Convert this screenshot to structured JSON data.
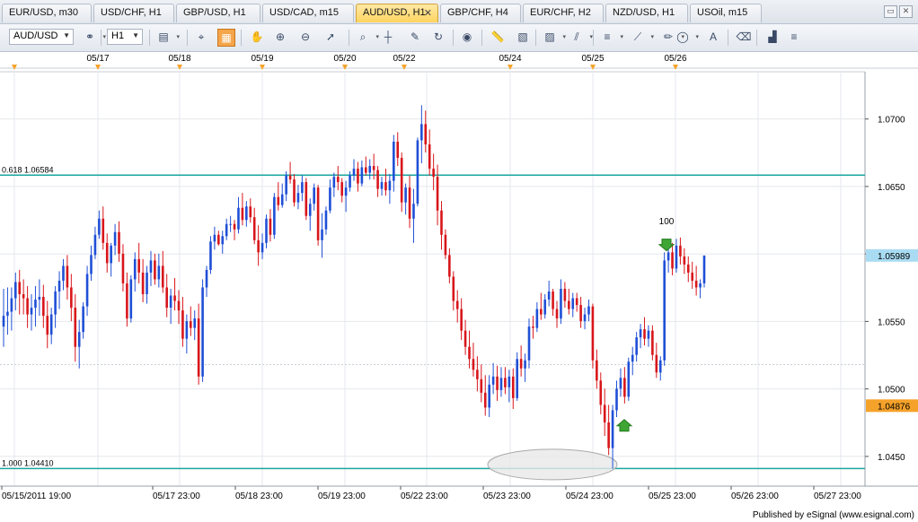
{
  "tabs": [
    {
      "label": "EUR/USD, m30",
      "active": false
    },
    {
      "label": "USD/CHF, H1",
      "active": false
    },
    {
      "label": "GBP/USD, H1",
      "active": false
    },
    {
      "label": "USD/CAD, m15",
      "active": false
    },
    {
      "label": "AUD/USD, H1",
      "active": true,
      "close": "✕"
    },
    {
      "label": "GBP/CHF, H4",
      "active": false
    },
    {
      "label": "EUR/CHF, H2",
      "active": false
    },
    {
      "label": "NZD/USD, H1",
      "active": false
    },
    {
      "label": "USOil, m15",
      "active": false
    }
  ],
  "toolbar": {
    "symbol": "AUD/USD",
    "interval": "H1",
    "icons": [
      "link-icon",
      "bar-chart-icon",
      "cursor-icon",
      "data-window-icon",
      "hand-icon",
      "zoom-in-icon",
      "zoom-out-icon",
      "pointer-icon",
      "zoom-box-icon",
      "crosshair-icon",
      "notes-icon",
      "rotate-icon",
      "globe-icon",
      "ruler-icon",
      "image-icon",
      "template-icon",
      "lines-icon",
      "fib-icon",
      "trend-icon",
      "pencil-icon",
      "ellipse-icon",
      "text-icon",
      "eraser-icon",
      "indicators-icon",
      "more-icon"
    ]
  },
  "chart_data": {
    "type": "candlestick",
    "symbol": "AUD/USD",
    "interval": "H1",
    "top_date_labels": [
      "05/17",
      "05/18",
      "05/19",
      "05/20",
      "05/22",
      "05/24",
      "05/25",
      "05/26"
    ],
    "x_labels": [
      "05/15/2011 19:00",
      "05/17 23:00",
      "05/18 23:00",
      "05/19 23:00",
      "05/22 23:00",
      "05/23 23:00",
      "05/24 23:00",
      "05/25 23:00",
      "05/26 23:00",
      "05/27 23:00"
    ],
    "y_ticks": [
      "1.0700",
      "1.0650",
      "1.0600",
      "1.0550",
      "1.0500",
      "1.0450"
    ],
    "ylim": [
      1.0428,
      1.0735
    ],
    "current_price": "1.05989",
    "marker_price": "1.04876",
    "levels": [
      {
        "label": "0.618 1.06584",
        "value": 1.06584
      },
      {
        "label": "1.000 1.04410",
        "value": 1.0441
      }
    ],
    "annotation_text": "100",
    "colors": {
      "up": "#1f4fd6",
      "down": "#d8161b",
      "level": "#1aa6a0",
      "current_bg": "#a9dcf3",
      "marker_bg": "#f5a22a",
      "grid": "#e4e7ec"
    },
    "ohlc": [
      [
        1.05462,
        1.05742,
        1.05312,
        1.05542
      ],
      [
        1.05542,
        1.05752,
        1.05402,
        1.05572
      ],
      [
        1.05572,
        1.05752,
        1.05432,
        1.05672
      ],
      [
        1.05672,
        1.05862,
        1.05582,
        1.05792
      ],
      [
        1.05792,
        1.05882,
        1.05552,
        1.05702
      ],
      [
        1.05702,
        1.05812,
        1.05552,
        1.05672
      ],
      [
        1.05672,
        1.05762,
        1.05452,
        1.05552
      ],
      [
        1.05552,
        1.05702,
        1.05432,
        1.05602
      ],
      [
        1.05602,
        1.05762,
        1.05462,
        1.05662
      ],
      [
        1.05662,
        1.05812,
        1.05542,
        1.05682
      ],
      [
        1.05682,
        1.05772,
        1.05452,
        1.05542
      ],
      [
        1.05542,
        1.05652,
        1.05302,
        1.05402
      ],
      [
        1.05402,
        1.05602,
        1.05332,
        1.05552
      ],
      [
        1.05552,
        1.05762,
        1.05452,
        1.05722
      ],
      [
        1.05722,
        1.05872,
        1.05592,
        1.05802
      ],
      [
        1.05802,
        1.05962,
        1.05732,
        1.05912
      ],
      [
        1.05912,
        1.05992,
        1.05662,
        1.05752
      ],
      [
        1.05752,
        1.05852,
        1.05502,
        1.05602
      ],
      [
        1.05602,
        1.05702,
        1.05202,
        1.05312
      ],
      [
        1.05312,
        1.05512,
        1.05152,
        1.05422
      ],
      [
        1.05422,
        1.05642,
        1.05372,
        1.05612
      ],
      [
        1.05612,
        1.05912,
        1.05542,
        1.05852
      ],
      [
        1.05852,
        1.06062,
        1.05802,
        1.05992
      ],
      [
        1.05992,
        1.06202,
        1.05962,
        1.06142
      ],
      [
        1.06142,
        1.06322,
        1.06112,
        1.06262
      ],
      [
        1.06262,
        1.06352,
        1.06032,
        1.06082
      ],
      [
        1.06082,
        1.06152,
        1.05862,
        1.05932
      ],
      [
        1.05932,
        1.06082,
        1.05832,
        1.06062
      ],
      [
        1.06062,
        1.06222,
        1.05992,
        1.06162
      ],
      [
        1.06162,
        1.06242,
        1.05942,
        1.06002
      ],
      [
        1.06002,
        1.06072,
        1.05722,
        1.05782
      ],
      [
        1.05782,
        1.05862,
        1.05462,
        1.05522
      ],
      [
        1.05522,
        1.05842,
        1.05492,
        1.05812
      ],
      [
        1.05812,
        1.06012,
        1.05722,
        1.05962
      ],
      [
        1.05962,
        1.06082,
        1.05782,
        1.05862
      ],
      [
        1.05862,
        1.05962,
        1.05642,
        1.05702
      ],
      [
        1.05702,
        1.05912,
        1.05632,
        1.05862
      ],
      [
        1.05862,
        1.06022,
        1.05762,
        1.05952
      ],
      [
        1.05952,
        1.06002,
        1.05772,
        1.05812
      ],
      [
        1.05812,
        1.06002,
        1.05752,
        1.05912
      ],
      [
        1.05912,
        1.06022,
        1.05712,
        1.05752
      ],
      [
        1.05752,
        1.05852,
        1.05532,
        1.05602
      ],
      [
        1.05602,
        1.05742,
        1.05482,
        1.05692
      ],
      [
        1.05692,
        1.05822,
        1.05582,
        1.05652
      ],
      [
        1.05652,
        1.05732,
        1.05482,
        1.05582
      ],
      [
        1.05582,
        1.05682,
        1.05312,
        1.05372
      ],
      [
        1.05372,
        1.05552,
        1.05262,
        1.05502
      ],
      [
        1.05502,
        1.05612,
        1.05392,
        1.05452
      ],
      [
        1.05452,
        1.05582,
        1.05362,
        1.05522
      ],
      [
        1.05522,
        1.05632,
        1.05032,
        1.05092
      ],
      [
        1.05092,
        1.05812,
        1.05052,
        1.05752
      ],
      [
        1.05752,
        1.05912,
        1.05682,
        1.05882
      ],
      [
        1.05882,
        1.06132,
        1.05852,
        1.06092
      ],
      [
        1.06092,
        1.06202,
        1.06032,
        1.06142
      ],
      [
        1.06142,
        1.06172,
        1.06062,
        1.06072
      ],
      [
        1.06072,
        1.06172,
        1.06002,
        1.06132
      ],
      [
        1.06132,
        1.06262,
        1.06102,
        1.06222
      ],
      [
        1.06222,
        1.06282,
        1.06162,
        1.06222
      ],
      [
        1.06222,
        1.06252,
        1.06102,
        1.06182
      ],
      [
        1.06182,
        1.06422,
        1.06152,
        1.06342
      ],
      [
        1.06342,
        1.06452,
        1.06212,
        1.06252
      ],
      [
        1.06252,
        1.06392,
        1.06202,
        1.06352
      ],
      [
        1.06352,
        1.06412,
        1.06232,
        1.06272
      ],
      [
        1.06272,
        1.06342,
        1.06072,
        1.06102
      ],
      [
        1.06102,
        1.06212,
        1.05912,
        1.06012
      ],
      [
        1.06012,
        1.06152,
        1.05962,
        1.06082
      ],
      [
        1.06082,
        1.06292,
        1.06042,
        1.06262
      ],
      [
        1.06262,
        1.06332,
        1.06092,
        1.06142
      ],
      [
        1.06142,
        1.06452,
        1.06112,
        1.06422
      ],
      [
        1.06422,
        1.06532,
        1.06322,
        1.06362
      ],
      [
        1.06362,
        1.06522,
        1.06342,
        1.06442
      ],
      [
        1.06442,
        1.06612,
        1.06392,
        1.06582
      ],
      [
        1.06582,
        1.06682,
        1.06522,
        1.06552
      ],
      [
        1.06552,
        1.06592,
        1.06352,
        1.06382
      ],
      [
        1.06382,
        1.06512,
        1.06332,
        1.06452
      ],
      [
        1.06452,
        1.06582,
        1.06392,
        1.06532
      ],
      [
        1.06532,
        1.06562,
        1.06252,
        1.06282
      ],
      [
        1.06282,
        1.06412,
        1.06172,
        1.06372
      ],
      [
        1.06372,
        1.06522,
        1.06322,
        1.06492
      ],
      [
        1.06492,
        1.06512,
        1.06062,
        1.06102
      ],
      [
        1.06102,
        1.06302,
        1.05972,
        1.06182
      ],
      [
        1.06182,
        1.06352,
        1.06142,
        1.06322
      ],
      [
        1.06322,
        1.06552,
        1.06302,
        1.06492
      ],
      [
        1.06492,
        1.06602,
        1.06422,
        1.06572
      ],
      [
        1.06572,
        1.06652,
        1.06472,
        1.06532
      ],
      [
        1.06532,
        1.06562,
        1.06382,
        1.06432
      ],
      [
        1.06432,
        1.06542,
        1.06312,
        1.06492
      ],
      [
        1.06492,
        1.06612,
        1.06462,
        1.06582
      ],
      [
        1.06582,
        1.06702,
        1.06542,
        1.06632
      ],
      [
        1.06632,
        1.06682,
        1.06462,
        1.06522
      ],
      [
        1.06522,
        1.06692,
        1.06502,
        1.06642
      ],
      [
        1.06642,
        1.06722,
        1.06582,
        1.06602
      ],
      [
        1.06602,
        1.06702,
        1.06552,
        1.06652
      ],
      [
        1.06652,
        1.06742,
        1.06552,
        1.06622
      ],
      [
        1.06622,
        1.06652,
        1.06422,
        1.06482
      ],
      [
        1.06482,
        1.06572,
        1.06432,
        1.06532
      ],
      [
        1.06532,
        1.06632,
        1.06432,
        1.06472
      ],
      [
        1.06472,
        1.06592,
        1.06372,
        1.06542
      ],
      [
        1.06542,
        1.06882,
        1.06462,
        1.06832
      ],
      [
        1.06832,
        1.06902,
        1.06652,
        1.06712
      ],
      [
        1.06712,
        1.06752,
        1.06312,
        1.06382
      ],
      [
        1.06382,
        1.06522,
        1.06292,
        1.06492
      ],
      [
        1.06492,
        1.06582,
        1.06192,
        1.06262
      ],
      [
        1.06262,
        1.06482,
        1.06082,
        1.06372
      ],
      [
        1.06372,
        1.06862,
        1.06352,
        1.06842
      ],
      [
        1.06842,
        1.07102,
        1.06672,
        1.06962
      ],
      [
        1.06962,
        1.07062,
        1.06752,
        1.06812
      ],
      [
        1.06812,
        1.06922,
        1.06582,
        1.06632
      ],
      [
        1.06632,
        1.06742,
        1.06472,
        1.06572
      ],
      [
        1.06572,
        1.06662,
        1.06212,
        1.06322
      ],
      [
        1.06322,
        1.06392,
        1.06032,
        1.06142
      ],
      [
        1.06142,
        1.06182,
        1.05962,
        1.05992
      ],
      [
        1.05992,
        1.06042,
        1.05782,
        1.05832
      ],
      [
        1.05832,
        1.05872,
        1.05582,
        1.05652
      ],
      [
        1.05652,
        1.05732,
        1.05492,
        1.05592
      ],
      [
        1.05592,
        1.05672,
        1.05362,
        1.05432
      ],
      [
        1.05432,
        1.05512,
        1.05252,
        1.05312
      ],
      [
        1.05312,
        1.05432,
        1.05152,
        1.05222
      ],
      [
        1.05222,
        1.05342,
        1.05092,
        1.05142
      ],
      [
        1.05142,
        1.05242,
        1.04982,
        1.05072
      ],
      [
        1.05072,
        1.05182,
        1.04902,
        1.04972
      ],
      [
        1.04972,
        1.05102,
        1.04802,
        1.04862
      ],
      [
        1.04862,
        1.05102,
        1.04792,
        1.05032
      ],
      [
        1.05032,
        1.05192,
        1.04962,
        1.05092
      ],
      [
        1.05092,
        1.05172,
        1.04912,
        1.04992
      ],
      [
        1.04992,
        1.05162,
        1.04942,
        1.05082
      ],
      [
        1.05082,
        1.05162,
        1.04962,
        1.05012
      ],
      [
        1.05012,
        1.05142,
        1.04902,
        1.05092
      ],
      [
        1.05092,
        1.05152,
        1.04852,
        1.04932
      ],
      [
        1.04932,
        1.05272,
        1.04912,
        1.05222
      ],
      [
        1.05222,
        1.05322,
        1.05092,
        1.05152
      ],
      [
        1.05152,
        1.05262,
        1.05052,
        1.05212
      ],
      [
        1.05212,
        1.05522,
        1.05152,
        1.05462
      ],
      [
        1.05462,
        1.05542,
        1.05372,
        1.05452
      ],
      [
        1.05452,
        1.05642,
        1.05422,
        1.05592
      ],
      [
        1.05592,
        1.05712,
        1.05512,
        1.05552
      ],
      [
        1.05552,
        1.05702,
        1.05522,
        1.05662
      ],
      [
        1.05662,
        1.05802,
        1.05612,
        1.05722
      ],
      [
        1.05722,
        1.05742,
        1.05542,
        1.05592
      ],
      [
        1.05592,
        1.05652,
        1.05452,
        1.05522
      ],
      [
        1.05522,
        1.05812,
        1.05482,
        1.05742
      ],
      [
        1.05742,
        1.05792,
        1.05602,
        1.05652
      ],
      [
        1.05652,
        1.05742,
        1.05552,
        1.05592
      ],
      [
        1.05592,
        1.05712,
        1.05532,
        1.05672
      ],
      [
        1.05672,
        1.05712,
        1.05572,
        1.05622
      ],
      [
        1.05622,
        1.05682,
        1.05452,
        1.05502
      ],
      [
        1.05502,
        1.05602,
        1.05442,
        1.05552
      ],
      [
        1.05552,
        1.05662,
        1.05502,
        1.05612
      ],
      [
        1.05612,
        1.05632,
        1.05152,
        1.05212
      ],
      [
        1.05212,
        1.05292,
        1.05002,
        1.05062
      ],
      [
        1.05062,
        1.05122,
        1.04812,
        1.04882
      ],
      [
        1.04882,
        1.05002,
        1.04652,
        1.04752
      ],
      [
        1.04752,
        1.04882,
        1.0451,
        1.04562
      ],
      [
        1.04562,
        1.04882,
        1.0441,
        1.04842
      ],
      [
        1.04842,
        1.05062,
        1.04792,
        1.05002
      ],
      [
        1.05002,
        1.05152,
        1.04942,
        1.05082
      ],
      [
        1.05082,
        1.05162,
        1.04892,
        1.04942
      ],
      [
        1.04942,
        1.05232,
        1.04912,
        1.05202
      ],
      [
        1.05202,
        1.05312,
        1.05102,
        1.05252
      ],
      [
        1.05252,
        1.05422,
        1.05202,
        1.05382
      ],
      [
        1.05382,
        1.05482,
        1.05302,
        1.05442
      ],
      [
        1.05442,
        1.05532,
        1.05322,
        1.05372
      ],
      [
        1.05372,
        1.05472,
        1.05312,
        1.05432
      ],
      [
        1.05432,
        1.05472,
        1.05212,
        1.05252
      ],
      [
        1.05252,
        1.05342,
        1.05082,
        1.05122
      ],
      [
        1.05122,
        1.05242,
        1.05062,
        1.05212
      ],
      [
        1.05212,
        1.06012,
        1.05172,
        1.05952
      ],
      [
        1.05952,
        1.06092,
        1.05862,
        1.06012
      ],
      [
        1.06012,
        1.06082,
        1.05842,
        1.05892
      ],
      [
        1.05892,
        1.06112,
        1.05862,
        1.06062
      ],
      [
        1.06062,
        1.06122,
        1.05922,
        1.05982
      ],
      [
        1.05982,
        1.06042,
        1.05852,
        1.05922
      ],
      [
        1.05922,
        1.05982,
        1.05792,
        1.05862
      ],
      [
        1.05862,
        1.05942,
        1.05742,
        1.05802
      ],
      [
        1.05802,
        1.05912,
        1.05692,
        1.05752
      ],
      [
        1.05752,
        1.05812,
        1.05672,
        1.05782
      ],
      [
        1.05782,
        1.05982,
        1.05752,
        1.05989
      ]
    ]
  }
}
